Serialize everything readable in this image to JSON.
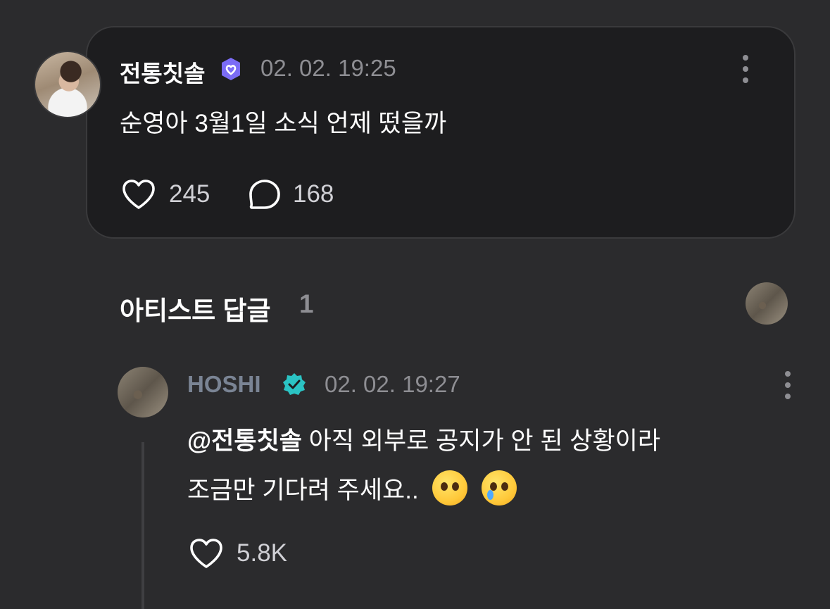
{
  "post": {
    "author": "전통칫솔",
    "timestamp": "02. 02. 19:25",
    "body": "순영아 3월1일 소식 언제 떴을까",
    "likes": "245",
    "comments": "168",
    "badge_color": "#7b6cf6"
  },
  "artist_section": {
    "title": "아티스트 답글",
    "count": "1"
  },
  "reply": {
    "author": "HOSHI",
    "timestamp": "02. 02. 19:27",
    "mention": "@전통칫솔",
    "text_line1": " 아직 외부로 공지가 안 된 상황이라",
    "text_line2": "조금만 기다려 주세요..",
    "likes": "5.8K",
    "badge_color": "#2bc4c4"
  },
  "icons": [
    "heart-icon",
    "comment-icon",
    "more-icon",
    "verified-badge-icon",
    "pleading-face-emoji",
    "tear-smile-emoji"
  ]
}
